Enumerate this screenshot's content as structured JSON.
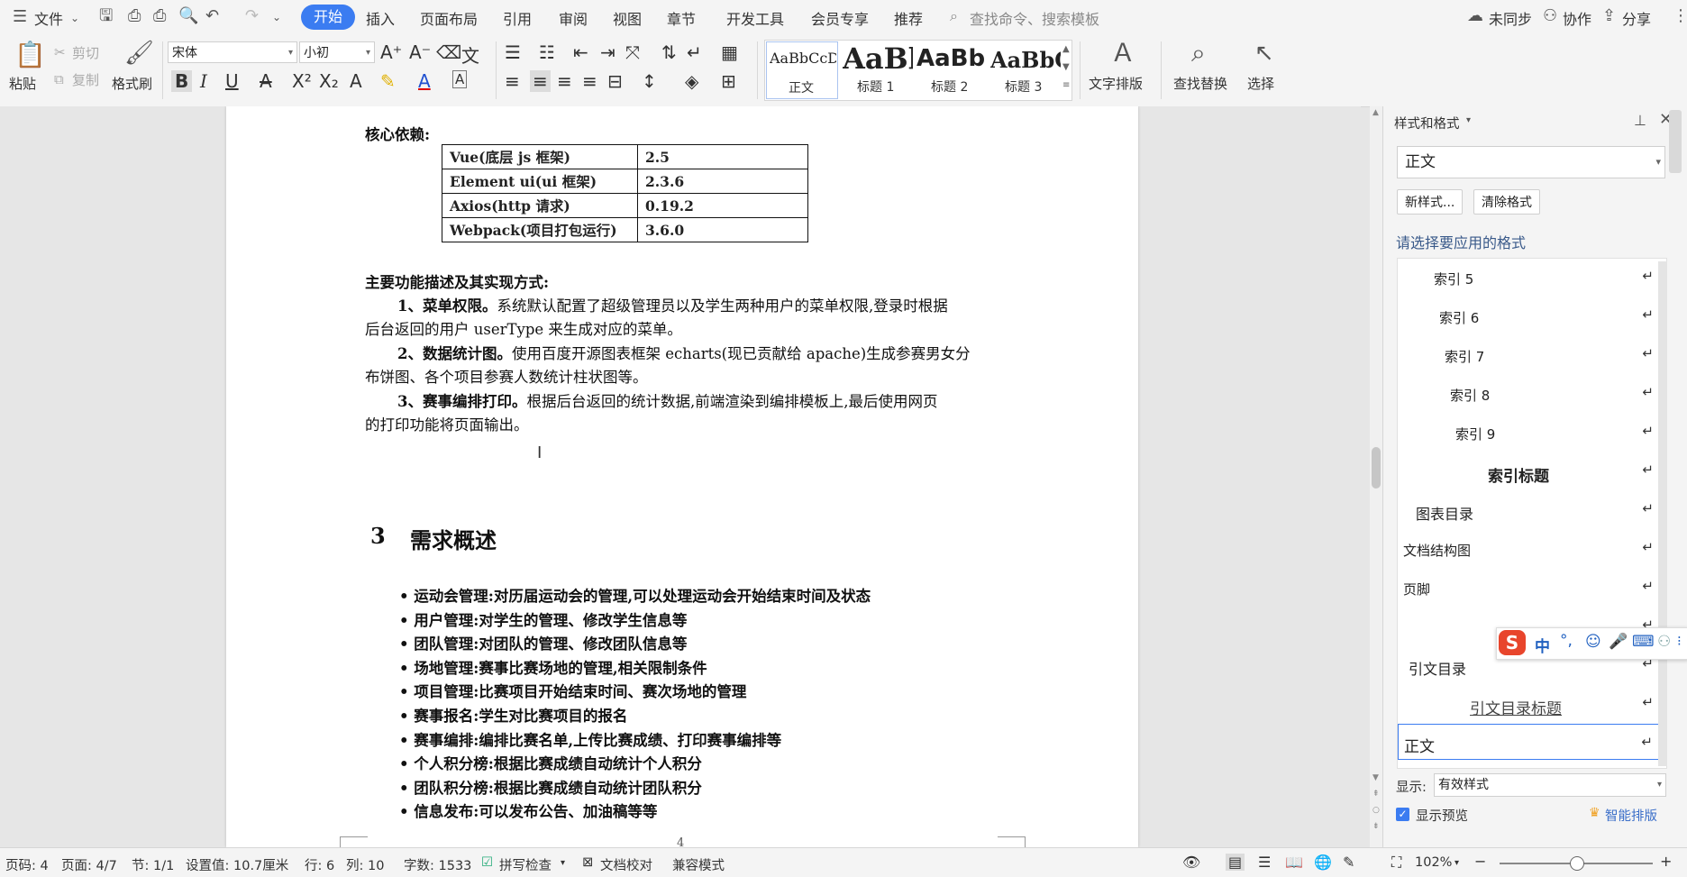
{
  "menubar": {
    "file": "文件",
    "tabs": [
      "开始",
      "插入",
      "页面布局",
      "引用",
      "审阅",
      "视图",
      "章节",
      "开发工具",
      "会员专享",
      "推荐"
    ],
    "active_tab": "开始",
    "search_placeholder": "查找命令、搜索模板",
    "sync": "未同步",
    "collab": "协作",
    "share": "分享"
  },
  "ribbon": {
    "paste": "粘贴",
    "cut": "剪切",
    "copy": "复制",
    "format_painter": "格式刷",
    "font_name": "宋体",
    "font_size": "小初",
    "styles": [
      {
        "sample": "AaBbCcDd",
        "name": "正文"
      },
      {
        "sample": "AaBl",
        "name": "标题 1"
      },
      {
        "sample": "AaBb(",
        "name": "标题 2"
      },
      {
        "sample": "AaBbC",
        "name": "标题 3"
      }
    ],
    "text_layout": "文字排版",
    "find_replace": "查找替换",
    "select": "选择"
  },
  "document": {
    "deps_heading": "核心依赖:",
    "deps": [
      {
        "name": "Vue(底层 js 框架)",
        "ver": "2.5"
      },
      {
        "name": "Element ui(ui 框架)",
        "ver": "2.3.6"
      },
      {
        "name": "Axios(http 请求)",
        "ver": "0.19.2"
      },
      {
        "name": "Webpack(项目打包运行)",
        "ver": "3.6.0"
      }
    ],
    "features_heading": "主要功能描述及其实现方式:",
    "f1_title": "1、菜单权限。",
    "f1_line1": "系统默认配置了超级管理员以及学生两种用户的菜单权限,登录时根据",
    "f1_line2": "后台返回的用户 userType 来生成对应的菜单。",
    "f2_title": "2、数据统计图。",
    "f2_line1": "使用百度开源图表框架 echarts(现已贡献给 apache)生成参赛男女分",
    "f2_line2": "布饼图、各个项目参赛人数统计柱状图等。",
    "f3_title": "3、赛事编排打印。",
    "f3_line1": "根据后台返回的统计数据,前端渲染到编排模板上,最后使用网页",
    "f3_line2": "的打印功能将页面输出。",
    "section_number": "3",
    "section_title": "需求概述",
    "bullets": [
      "运动会管理:对历届运动会的管理,可以处理运动会开始结束时间及状态",
      "用户管理:对学生的管理、修改学生信息等",
      "团队管理:对团队的管理、修改团队信息等",
      "场地管理:赛事比赛场地的管理,相关限制条件",
      "项目管理:比赛项目开始结束时间、赛次场地的管理",
      "赛事报名:学生对比赛项目的报名",
      "赛事编排:编排比赛名单,上传比赛成绩、打印赛事编排等",
      "个人积分榜:根据比赛成绩自动统计个人积分",
      "团队积分榜:根据比赛成绩自动统计团队积分",
      "信息发布:可以发布公告、加油稿等等"
    ],
    "page_number": "4"
  },
  "panel": {
    "title": "样式和格式",
    "current_style": "正文",
    "new_style": "新样式...",
    "clear_format": "清除格式",
    "choose_label": "请选择要应用的格式",
    "styles": [
      "索引 5",
      "索引 6",
      "索引 7",
      "索引 8",
      "索引 9",
      "索引标题",
      "图表目录",
      "文档结构图",
      "页脚",
      "",
      "引文目录",
      "引文目录标题",
      "正文"
    ],
    "show_label": "显示:",
    "show_value": "有效样式",
    "show_preview": "显示预览",
    "smart_layout": "智能排版"
  },
  "ime": {
    "lang": "中"
  },
  "status": {
    "page_code": "页码: 4",
    "page": "页面: 4/7",
    "section": "节: 1/1",
    "setting": "设置值: 10.7厘米",
    "row": "行: 6",
    "col": "列: 10",
    "words": "字数: 1533",
    "spell": "拼写检查",
    "proof": "文档校对",
    "compat": "兼容模式",
    "zoom": "102%"
  },
  "colors": {
    "accent": "#3b7cf1",
    "spell_error": "#dd3333",
    "crown": "#f0a020"
  }
}
